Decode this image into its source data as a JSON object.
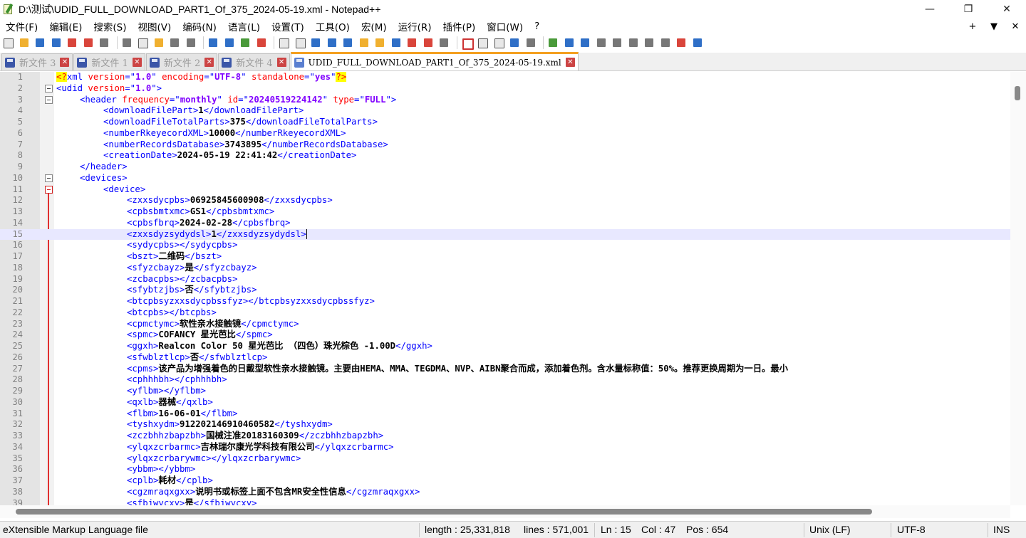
{
  "window": {
    "title": "D:\\测试\\UDID_FULL_DOWNLOAD_PART1_Of_375_2024-05-19.xml - Notepad++",
    "minimize_glyph": "—",
    "maximize_glyph": "❐",
    "close_glyph": "✕"
  },
  "menu": {
    "items": [
      "文件(F)",
      "编辑(E)",
      "搜索(S)",
      "视图(V)",
      "编码(N)",
      "语言(L)",
      "设置(T)",
      "工具(O)",
      "宏(M)",
      "运行(R)",
      "插件(P)",
      "窗口(W)",
      "?"
    ],
    "right": [
      "+",
      "▼",
      "✕"
    ]
  },
  "tabs": [
    {
      "label": "新文件 3",
      "active": false
    },
    {
      "label": "新文件 1",
      "active": false
    },
    {
      "label": "新文件 2",
      "active": false
    },
    {
      "label": "新文件 4",
      "active": false
    },
    {
      "label": "UDID_FULL_DOWNLOAD_PART1_Of_375_2024-05-19.xml",
      "active": true
    }
  ],
  "tab_close_glyph": "✕",
  "editor": {
    "current_line": 15,
    "lines": [
      {
        "n": "1",
        "indent": 0,
        "parts": [
          [
            "pi",
            "<?"
          ],
          [
            "tag",
            "xml "
          ],
          [
            "attr",
            "version"
          ],
          [
            "tag",
            "=\""
          ],
          [
            "val",
            "1.0"
          ],
          [
            "tag",
            "\" "
          ],
          [
            "attr",
            "encoding"
          ],
          [
            "tag",
            "=\""
          ],
          [
            "val",
            "UTF-8"
          ],
          [
            "tag",
            "\" "
          ],
          [
            "attr",
            "standalone"
          ],
          [
            "tag",
            "=\""
          ],
          [
            "val",
            "yes"
          ],
          [
            "tag",
            "\""
          ],
          [
            "pi",
            "?>"
          ]
        ]
      },
      {
        "n": "2",
        "indent": 0,
        "fold": "box",
        "parts": [
          [
            "tag",
            "<udid "
          ],
          [
            "attr",
            "version"
          ],
          [
            "tag",
            "=\""
          ],
          [
            "val",
            "1.0"
          ],
          [
            "tag",
            "\">"
          ]
        ]
      },
      {
        "n": "3",
        "indent": 1,
        "fold": "box",
        "parts": [
          [
            "tag",
            "<header "
          ],
          [
            "attr",
            "frequency"
          ],
          [
            "tag",
            "=\""
          ],
          [
            "val",
            "monthly"
          ],
          [
            "tag",
            "\" "
          ],
          [
            "attr",
            "id"
          ],
          [
            "tag",
            "=\""
          ],
          [
            "val",
            "20240519224142"
          ],
          [
            "tag",
            "\" "
          ],
          [
            "attr",
            "type"
          ],
          [
            "tag",
            "=\""
          ],
          [
            "val",
            "FULL"
          ],
          [
            "tag",
            "\">"
          ]
        ]
      },
      {
        "n": "4",
        "indent": 2,
        "parts": [
          [
            "tag",
            "<downloadFilePart>"
          ],
          [
            "content",
            "1"
          ],
          [
            "tag",
            "</downloadFilePart>"
          ]
        ]
      },
      {
        "n": "5",
        "indent": 2,
        "parts": [
          [
            "tag",
            "<downloadFileTotalParts>"
          ],
          [
            "content",
            "375"
          ],
          [
            "tag",
            "</downloadFileTotalParts>"
          ]
        ]
      },
      {
        "n": "6",
        "indent": 2,
        "parts": [
          [
            "tag",
            "<numberRkeyecordXML>"
          ],
          [
            "content",
            "10000"
          ],
          [
            "tag",
            "</numberRkeyecordXML>"
          ]
        ]
      },
      {
        "n": "7",
        "indent": 2,
        "parts": [
          [
            "tag",
            "<numberRecordsDatabase>"
          ],
          [
            "content",
            "3743895"
          ],
          [
            "tag",
            "</numberRecordsDatabase>"
          ]
        ]
      },
      {
        "n": "8",
        "indent": 2,
        "parts": [
          [
            "tag",
            "<creationDate>"
          ],
          [
            "content",
            "2024-05-19 22:41:42"
          ],
          [
            "tag",
            "</creationDate>"
          ]
        ]
      },
      {
        "n": "9",
        "indent": 1,
        "parts": [
          [
            "tag",
            "</header>"
          ]
        ]
      },
      {
        "n": "10",
        "indent": 1,
        "fold": "box",
        "parts": [
          [
            "tag",
            "<devices>"
          ]
        ]
      },
      {
        "n": "11",
        "indent": 2,
        "fold": "red",
        "parts": [
          [
            "tag",
            "<device>"
          ]
        ]
      },
      {
        "n": "12",
        "indent": 3,
        "parts": [
          [
            "tag",
            "<zxxsdycpbs>"
          ],
          [
            "content",
            "06925845600908"
          ],
          [
            "tag",
            "</zxxsdycpbs>"
          ]
        ]
      },
      {
        "n": "13",
        "indent": 3,
        "parts": [
          [
            "tag",
            "<cpbsbmtxmc>"
          ],
          [
            "content",
            "GS1"
          ],
          [
            "tag",
            "</cpbsbmtxmc>"
          ]
        ]
      },
      {
        "n": "14",
        "indent": 3,
        "parts": [
          [
            "tag",
            "<cpbsfbrq>"
          ],
          [
            "content",
            "2024-02-28"
          ],
          [
            "tag",
            "</cpbsfbrq>"
          ]
        ]
      },
      {
        "n": "15",
        "indent": 3,
        "cursor": true,
        "parts": [
          [
            "tag",
            "<zxxsdyzsydydsl>"
          ],
          [
            "content",
            "1"
          ],
          [
            "tag",
            "</zxxsdyzsydydsl>"
          ]
        ]
      },
      {
        "n": "16",
        "indent": 3,
        "parts": [
          [
            "tag",
            "<sydycpbs></sydycpbs>"
          ]
        ]
      },
      {
        "n": "17",
        "indent": 3,
        "parts": [
          [
            "tag",
            "<bszt>"
          ],
          [
            "content",
            "二维码"
          ],
          [
            "tag",
            "</bszt>"
          ]
        ]
      },
      {
        "n": "18",
        "indent": 3,
        "parts": [
          [
            "tag",
            "<sfyzcbayz>"
          ],
          [
            "content",
            "是"
          ],
          [
            "tag",
            "</sfyzcbayz>"
          ]
        ]
      },
      {
        "n": "19",
        "indent": 3,
        "parts": [
          [
            "tag",
            "<zcbacpbs></zcbacpbs>"
          ]
        ]
      },
      {
        "n": "20",
        "indent": 3,
        "parts": [
          [
            "tag",
            "<sfybtzjbs>"
          ],
          [
            "content",
            "否"
          ],
          [
            "tag",
            "</sfybtzjbs>"
          ]
        ]
      },
      {
        "n": "21",
        "indent": 3,
        "parts": [
          [
            "tag",
            "<btcpbsyzxxsdycpbssfyz></btcpbsyzxxsdycpbssfyz>"
          ]
        ]
      },
      {
        "n": "22",
        "indent": 3,
        "parts": [
          [
            "tag",
            "<btcpbs></btcpbs>"
          ]
        ]
      },
      {
        "n": "23",
        "indent": 3,
        "parts": [
          [
            "tag",
            "<cpmctymc>"
          ],
          [
            "content",
            "软性亲水接触镜"
          ],
          [
            "tag",
            "</cpmctymc>"
          ]
        ]
      },
      {
        "n": "24",
        "indent": 3,
        "parts": [
          [
            "tag",
            "<spmc>"
          ],
          [
            "content",
            "COFANCY 星光芭比"
          ],
          [
            "tag",
            "</spmc>"
          ]
        ]
      },
      {
        "n": "25",
        "indent": 3,
        "parts": [
          [
            "tag",
            "<ggxh>"
          ],
          [
            "content",
            "Realcon Color 50 星光芭比 （四色）珠光棕色 -1.00D"
          ],
          [
            "tag",
            "</ggxh>"
          ]
        ]
      },
      {
        "n": "26",
        "indent": 3,
        "parts": [
          [
            "tag",
            "<sfwblztlcp>"
          ],
          [
            "content",
            "否"
          ],
          [
            "tag",
            "</sfwblztlcp>"
          ]
        ]
      },
      {
        "n": "27",
        "indent": 3,
        "parts": [
          [
            "tag",
            "<cpms>"
          ],
          [
            "content",
            "该产品为增强着色的日戴型软性亲水接触镜。主要由HEMA、MMA、TEGDMA、NVP、AIBN聚合而成，添加着色剂。含水量标称值：50%。推荐更换周期为一日。最小"
          ]
        ]
      },
      {
        "n": "28",
        "indent": 3,
        "parts": [
          [
            "tag",
            "<cphhhbh></cphhhbh>"
          ]
        ]
      },
      {
        "n": "29",
        "indent": 3,
        "parts": [
          [
            "tag",
            "<yflbm></yflbm>"
          ]
        ]
      },
      {
        "n": "30",
        "indent": 3,
        "parts": [
          [
            "tag",
            "<qxlb>"
          ],
          [
            "content",
            "器械"
          ],
          [
            "tag",
            "</qxlb>"
          ]
        ]
      },
      {
        "n": "31",
        "indent": 3,
        "parts": [
          [
            "tag",
            "<flbm>"
          ],
          [
            "content",
            "16-06-01"
          ],
          [
            "tag",
            "</flbm>"
          ]
        ]
      },
      {
        "n": "32",
        "indent": 3,
        "parts": [
          [
            "tag",
            "<tyshxydm>"
          ],
          [
            "content",
            "912202146910460582"
          ],
          [
            "tag",
            "</tyshxydm>"
          ]
        ]
      },
      {
        "n": "33",
        "indent": 3,
        "parts": [
          [
            "tag",
            "<zczbhhzbapzbh>"
          ],
          [
            "content",
            "国械注准20183160309"
          ],
          [
            "tag",
            "</zczbhhzbapzbh>"
          ]
        ]
      },
      {
        "n": "34",
        "indent": 3,
        "parts": [
          [
            "tag",
            "<ylqxzcrbarmc>"
          ],
          [
            "content",
            "吉林瑞尔康光学科技有限公司"
          ],
          [
            "tag",
            "</ylqxzcrbarmc>"
          ]
        ]
      },
      {
        "n": "35",
        "indent": 3,
        "parts": [
          [
            "tag",
            "<ylqxzcrbarywmc></ylqxzcrbarywmc>"
          ]
        ]
      },
      {
        "n": "36",
        "indent": 3,
        "parts": [
          [
            "tag",
            "<ybbm></ybbm>"
          ]
        ]
      },
      {
        "n": "37",
        "indent": 3,
        "parts": [
          [
            "tag",
            "<cplb>"
          ],
          [
            "content",
            "耗材"
          ],
          [
            "tag",
            "</cplb>"
          ]
        ]
      },
      {
        "n": "38",
        "indent": 3,
        "parts": [
          [
            "tag",
            "<cgzmraqxgxx>"
          ],
          [
            "content",
            "说明书或标签上面不包含MR安全性信息"
          ],
          [
            "tag",
            "</cgzmraqxgxx>"
          ]
        ]
      },
      {
        "n": "39",
        "indent": 3,
        "parts": [
          [
            "tag",
            "<sfbjwycxy>"
          ],
          [
            "content",
            "是"
          ],
          [
            "tag",
            "</sfbjwycxy>"
          ]
        ]
      }
    ]
  },
  "colors": {
    "tag": "#0000ff",
    "attribute": "#ff0000",
    "value": "#8000ff",
    "active_tab_accent": "#f4a020",
    "current_line_bg": "#e8e8ff"
  },
  "toolbar_icons": [
    "new-file-icon",
    "open-file-icon",
    "save-icon",
    "save-all-icon",
    "close-icon",
    "close-all-icon",
    "print-icon",
    "cut-icon",
    "copy-icon",
    "paste-icon",
    "undo-icon",
    "redo-icon",
    "find-icon",
    "replace-icon",
    "zoom-in-icon",
    "zoom-out-icon",
    "sync-vertical-icon",
    "sync-horizontal-icon",
    "word-wrap-icon",
    "show-all-chars-icon",
    "indent-guide-icon",
    "doc-map-icon",
    "function-list-icon",
    "folder-workspace-icon",
    "doc-switcher-icon",
    "monitoring-icon",
    "record-macro-icon",
    "stop-record-icon",
    "playback-icon",
    "run-macro-multiple-icon",
    "save-macro-icon",
    "xml-tools-icon",
    "compare-icon",
    "diff-next-icon",
    "diff-prev-icon",
    "first-diff-icon",
    "last-diff-icon",
    "clear-compare-icon",
    "settings-icon"
  ],
  "status": {
    "file_type": "eXtensible Markup Language file",
    "length": "length : 25,331,818",
    "lines": "lines : 571,001",
    "ln": "Ln : 15",
    "col": "Col : 47",
    "pos": "Pos : 654",
    "eol": "Unix (LF)",
    "encoding": "UTF-8",
    "mode": "INS"
  }
}
